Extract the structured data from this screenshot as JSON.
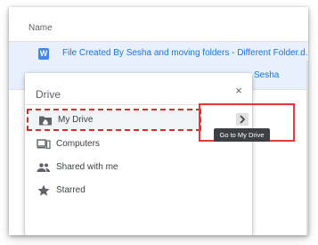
{
  "file_list": {
    "column_header": "Name",
    "rows": [
      {
        "icon": "word-icon",
        "icon_letter": "W",
        "name": "File Created By Sesha and moving folders - Different Folder.d...",
        "selected": true
      },
      {
        "name": "Sesha"
      }
    ]
  },
  "drive_panel": {
    "title": "Drive",
    "close_glyph": "×",
    "items": [
      {
        "label": "My Drive",
        "icon": "my-drive-icon",
        "selected": true
      },
      {
        "label": "Computers",
        "icon": "computers-icon",
        "selected": false
      },
      {
        "label": "Shared with me",
        "icon": "shared-with-me-icon",
        "selected": false
      },
      {
        "label": "Starred",
        "icon": "star-icon",
        "selected": false
      }
    ]
  },
  "open_folder_button": {
    "glyph": "›",
    "icon": "chevron-right-icon"
  },
  "tooltip": {
    "text": "Go to My Drive"
  },
  "colors": {
    "accent_blue": "#1a73e8",
    "selection_bg": "#e8f0fe",
    "annotation_red": "#e53935",
    "icon_gray": "#5f6368"
  }
}
